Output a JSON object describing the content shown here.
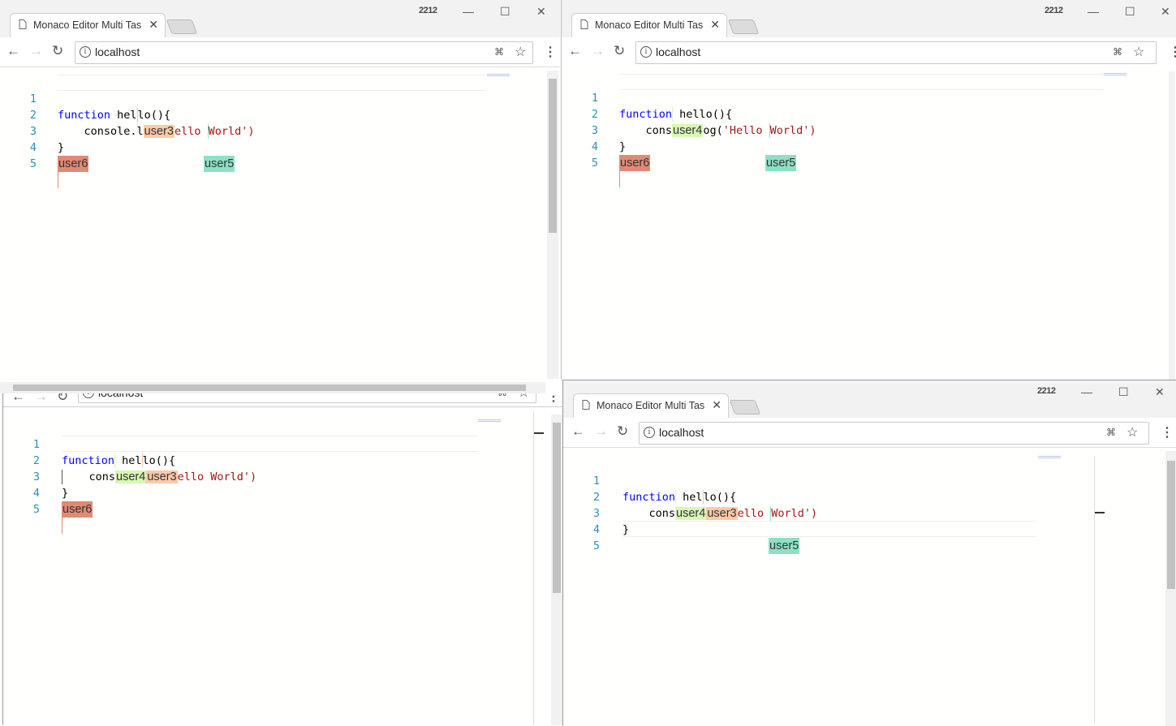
{
  "tab_title": "Monaco Editor Multi Tas",
  "window_badge": "2212",
  "url": "localhost",
  "icons": [
    "document-icon",
    "close-icon",
    "back-arrow-icon",
    "forward-arrow-icon",
    "reload-icon",
    "info-icon",
    "translate-icon",
    "star-icon",
    "menu-icon",
    "minimize-icon",
    "maximize-icon",
    "close-window-icon"
  ],
  "colors": {
    "user3": "#fdc9a6",
    "user4": "#d8f7b5",
    "user5": "#8ee0c5",
    "user6": "#e08a74",
    "keyword": "#0000ff",
    "string": "#a31515",
    "line_number": "#2b91af"
  },
  "line_numbers": [
    "1",
    "2",
    "3",
    "4",
    "5"
  ],
  "windows": {
    "tl": {
      "l1": {
        "kw": "function",
        "rest1": " hel",
        "rest2": "lo(){"
      },
      "l2": {
        "pre": "    console.l",
        "t1": "user3",
        "mid": "ello ",
        "str": "World",
        "post": "')"
      },
      "l3": {
        "brace": "}",
        "t5": "user5"
      },
      "l4": {
        "t6": "user6"
      }
    },
    "tr": {
      "l1": {
        "kw": "function",
        "rest1": " hel",
        "rest2": "lo(){"
      },
      "l2": {
        "pre": "    cons",
        "t1": "user4",
        "mid": "og(",
        "str": "'Hello ",
        "str2": "World",
        "post": "')"
      },
      "l3": {
        "brace": "}",
        "t5": "user5"
      },
      "l4": {
        "t6": "user6"
      }
    },
    "bl": {
      "l1": {
        "kw": "function",
        "rest1": " hel",
        "rest2": "lo(){"
      },
      "l2": {
        "pre": "    cons",
        "t1": "user4",
        "t2": "user3",
        "mid": "ello ",
        "str": "World",
        "post": "')"
      },
      "l3": {
        "brace": "}"
      },
      "l4": {
        "t6": "user6"
      }
    },
    "br": {
      "l1": {
        "kw": "function",
        "rest1": " hel",
        "rest2": "lo(){"
      },
      "l2": {
        "pre": "    cons",
        "t1": "user4",
        "t2": "user3",
        "mid": "ello ",
        "str": "World",
        "post": "')"
      },
      "l3": {
        "brace": "}",
        "t5": "user5"
      }
    }
  }
}
